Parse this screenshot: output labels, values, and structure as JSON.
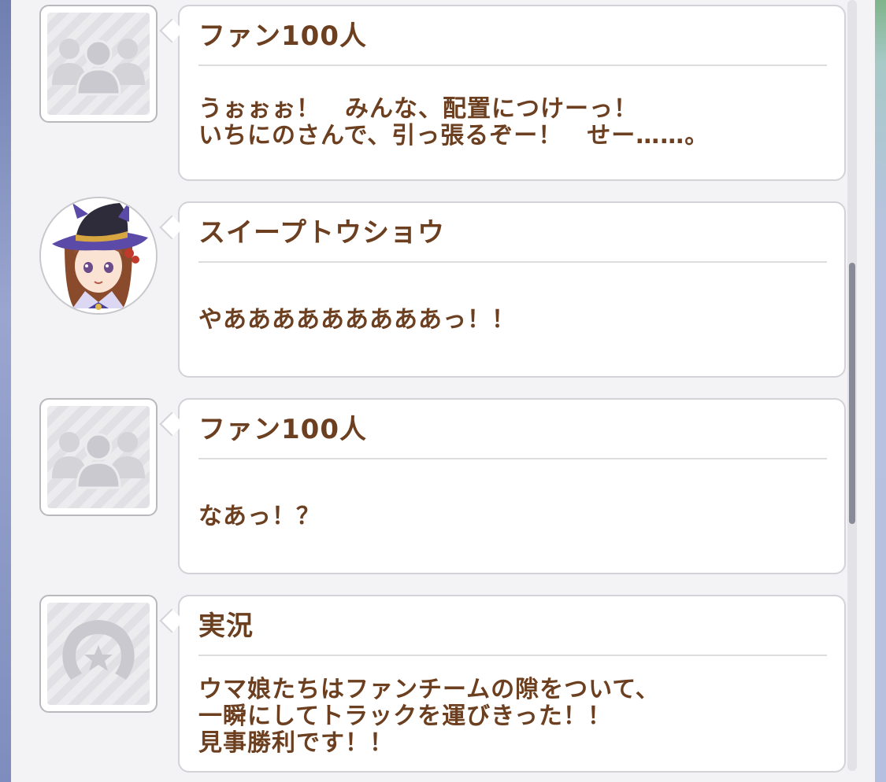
{
  "messages": [
    {
      "speaker": "ファン100人",
      "avatar": "fans-group-icon",
      "lines": [
        "うぉぉぉ！　みんな、配置につけーっ！",
        "いちにのさんで、引っ張るぞー！　せー……。"
      ]
    },
    {
      "speaker": "スイープトウショウ",
      "avatar": "sweep-tosho-portrait",
      "lines": [
        "やあああああああああっ！！"
      ]
    },
    {
      "speaker": "ファン100人",
      "avatar": "fans-group-icon",
      "lines": [
        "なあっ！？"
      ]
    },
    {
      "speaker": "実況",
      "avatar": "horseshoe-star-icon",
      "lines": [
        "ウマ娘たちはファンチームの隙をついて、",
        "一瞬にしてトラックを運びきった！！",
        "見事勝利です！！"
      ]
    }
  ],
  "colors": {
    "text": "#6b3f1f",
    "panel": "#f3f3f5",
    "bubble": "#ffffff",
    "scrollbar": "#898a98"
  }
}
